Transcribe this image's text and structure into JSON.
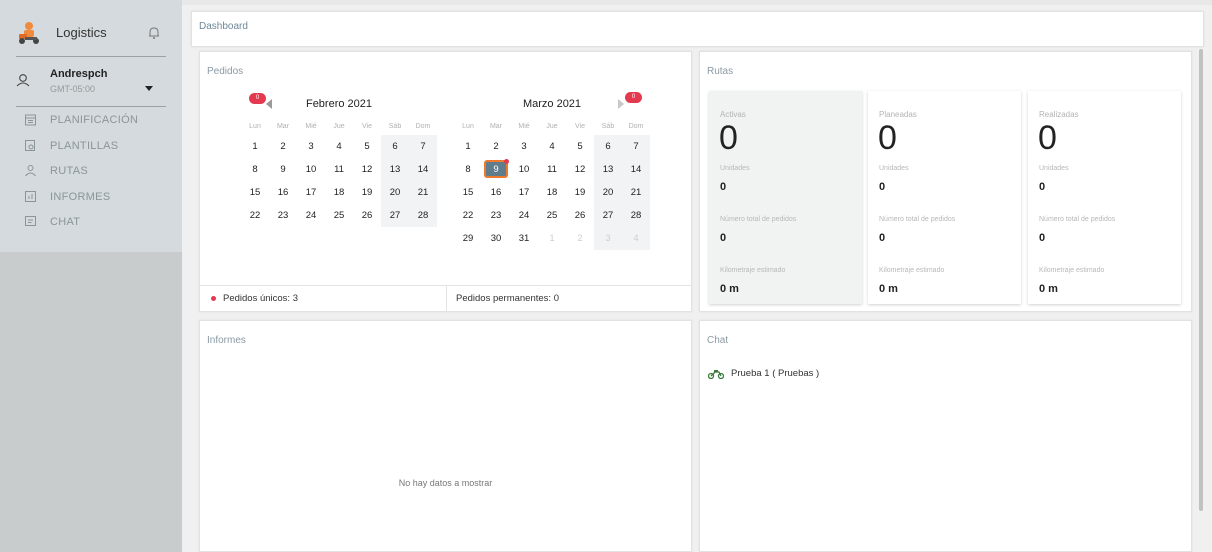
{
  "app": {
    "name": "Logistics"
  },
  "user": {
    "name": "Andrespch",
    "timezone": "GMT-05:00"
  },
  "menu": [
    {
      "label": "PLANIFICACIÓN",
      "icon": "calendar-icon"
    },
    {
      "label": "PLANTILLAS",
      "icon": "template-icon"
    },
    {
      "label": "RUTAS",
      "icon": "route-icon"
    },
    {
      "label": "INFORMES",
      "icon": "chart-icon"
    },
    {
      "label": "CHAT",
      "icon": "chat-icon"
    }
  ],
  "header": {
    "title": "Dashboard"
  },
  "pedidos": {
    "title": "Pedidos",
    "weekdays": [
      "Lun",
      "Mar",
      "Mié",
      "Jue",
      "Vie",
      "Sáb",
      "Dom"
    ],
    "prev_badge": "0",
    "next_badge": "0",
    "calendars": [
      {
        "title": "Febrero 2021",
        "weeks": [
          [
            "1",
            "2",
            "3",
            "4",
            "5",
            "6",
            "7"
          ],
          [
            "8",
            "9",
            "10",
            "11",
            "12",
            "13",
            "14"
          ],
          [
            "15",
            "16",
            "17",
            "18",
            "19",
            "20",
            "21"
          ],
          [
            "22",
            "23",
            "24",
            "25",
            "26",
            "27",
            "28"
          ]
        ]
      },
      {
        "title": "Marzo 2021",
        "weeks": [
          [
            "1",
            "2",
            "3",
            "4",
            "5",
            "6",
            "7"
          ],
          [
            "8",
            "9",
            "10",
            "11",
            "12",
            "13",
            "14"
          ],
          [
            "15",
            "16",
            "17",
            "18",
            "19",
            "20",
            "21"
          ],
          [
            "22",
            "23",
            "24",
            "25",
            "26",
            "27",
            "28"
          ],
          [
            "29",
            "30",
            "31",
            "1",
            "2",
            "3",
            "4"
          ]
        ],
        "selected_day": "9"
      }
    ],
    "footer": {
      "unicos": "Pedidos únicos: 3",
      "permanentes": "Pedidos permanentes: 0"
    }
  },
  "rutas": {
    "title": "Rutas",
    "cards": [
      {
        "title": "Activas",
        "count": "0",
        "unidades_label": "Unidades",
        "unidades": "0",
        "pedidos_label": "Número total de pedidos",
        "pedidos": "0",
        "km_label": "Kilometraje estimado",
        "km": "0 m"
      },
      {
        "title": "Planeadas",
        "count": "0",
        "unidades_label": "Unidades",
        "unidades": "0",
        "pedidos_label": "Número total de pedidos",
        "pedidos": "0",
        "km_label": "Kilometraje estimado",
        "km": "0 m"
      },
      {
        "title": "Realizadas",
        "count": "0",
        "unidades_label": "Unidades",
        "unidades": "0",
        "pedidos_label": "Número total de pedidos",
        "pedidos": "0",
        "km_label": "Kilometraje estimado",
        "km": "0 m"
      }
    ]
  },
  "informes": {
    "title": "Informes",
    "empty": "No hay datos a mostrar"
  },
  "chat": {
    "title": "Chat",
    "items": [
      {
        "label": "Prueba 1 ( Pruebas )",
        "icon": "motorbike-icon"
      }
    ]
  },
  "colors": {
    "accent": "#ee7b2d",
    "badge": "#e53950",
    "sidebar": "#d4dadd",
    "selected": "#607d8b"
  }
}
